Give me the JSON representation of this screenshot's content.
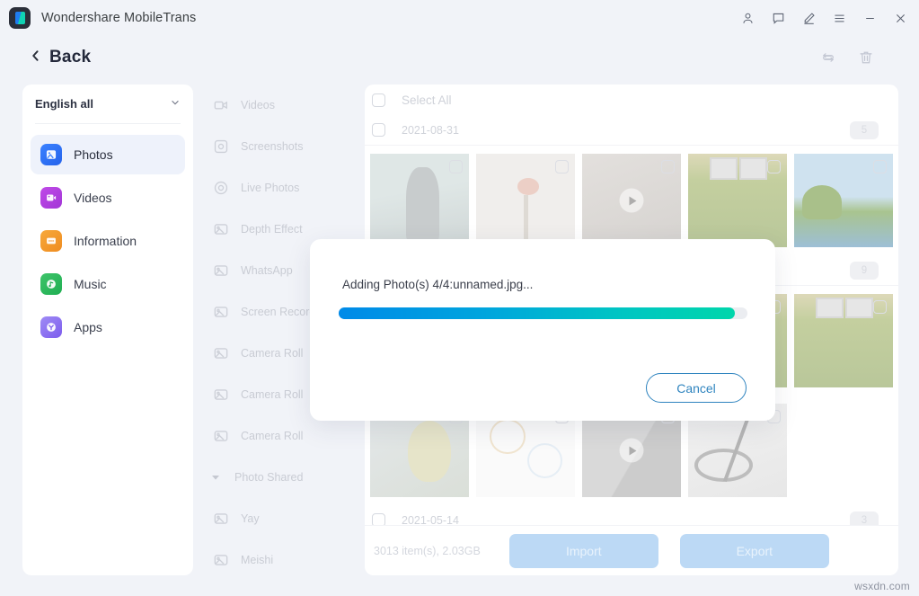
{
  "window": {
    "app_title": "Wondershare MobileTrans",
    "logo_icon": "mobiletrans-logo-icon",
    "controls": [
      {
        "name": "account-icon",
        "label": "Account"
      },
      {
        "name": "feedback-icon",
        "label": "Feedback"
      },
      {
        "name": "edit-icon",
        "label": "Edit"
      },
      {
        "name": "menu-icon",
        "label": "Menu"
      },
      {
        "name": "minimize-icon",
        "label": "Minimize"
      },
      {
        "name": "close-icon",
        "label": "Close"
      }
    ]
  },
  "header": {
    "back_label": "Back",
    "back_icon": "chevron-left-icon",
    "tools": [
      {
        "name": "refresh-icon",
        "label": "Refresh"
      },
      {
        "name": "trash-icon",
        "label": "Delete"
      }
    ]
  },
  "sidebar": {
    "language_selector": {
      "value": "English all",
      "caret_icon": "chevron-down-icon"
    },
    "items": [
      {
        "label": "Photos",
        "icon": "photos-icon",
        "active": true
      },
      {
        "label": "Videos",
        "icon": "videos-icon",
        "active": false
      },
      {
        "label": "Information",
        "icon": "information-icon",
        "active": false
      },
      {
        "label": "Music",
        "icon": "music-icon",
        "active": false
      },
      {
        "label": "Apps",
        "icon": "apps-icon",
        "active": false
      }
    ]
  },
  "albums": {
    "items": [
      {
        "label": "Videos",
        "icon": "video-album-icon",
        "type": "album"
      },
      {
        "label": "Screenshots",
        "icon": "screenshot-album-icon",
        "type": "album"
      },
      {
        "label": "Live Photos",
        "icon": "live-photo-album-icon",
        "type": "album"
      },
      {
        "label": "Depth Effect",
        "icon": "photo-album-icon",
        "type": "album"
      },
      {
        "label": "WhatsApp",
        "icon": "photo-album-icon",
        "type": "album"
      },
      {
        "label": "Screen Recorder",
        "icon": "photo-album-icon",
        "type": "album"
      },
      {
        "label": "Camera Roll",
        "icon": "photo-album-icon",
        "type": "album"
      },
      {
        "label": "Camera Roll",
        "icon": "photo-album-icon",
        "type": "album"
      },
      {
        "label": "Camera Roll",
        "icon": "photo-album-icon",
        "type": "album"
      },
      {
        "label": "Photo Shared",
        "icon": "caret-down-icon",
        "type": "group"
      },
      {
        "label": "Yay",
        "icon": "photo-album-icon",
        "type": "album"
      },
      {
        "label": "Meishi",
        "icon": "photo-album-icon",
        "type": "album"
      }
    ]
  },
  "content": {
    "select_all_label": "Select All",
    "date_groups": [
      {
        "date": "2021-08-31",
        "count": "5"
      },
      {
        "date": "",
        "count": "9"
      },
      {
        "date": "2021-05-14",
        "count": "3"
      }
    ],
    "thumbnails_row1": [
      {
        "name": "thumbnail-person",
        "kind": "photo"
      },
      {
        "name": "thumbnail-flowers",
        "kind": "photo"
      },
      {
        "name": "thumbnail-video-hand",
        "kind": "video"
      },
      {
        "name": "thumbnail-hedge",
        "kind": "photo"
      },
      {
        "name": "thumbnail-beach",
        "kind": "photo"
      }
    ],
    "thumbnails_row2": [
      {
        "name": "thumbnail-grass",
        "kind": "photo"
      }
    ],
    "thumbnails_row3": [
      {
        "name": "thumbnail-painting",
        "kind": "photo"
      },
      {
        "name": "thumbnail-infographic",
        "kind": "photo"
      },
      {
        "name": "thumbnail-video-room",
        "kind": "video"
      },
      {
        "name": "thumbnail-cable",
        "kind": "photo"
      }
    ],
    "footer": {
      "stats": "3013 item(s), 2.03GB",
      "import_label": "Import",
      "export_label": "Export"
    }
  },
  "dialog": {
    "message": "Adding Photo(s) 4/4:unnamed.jpg...",
    "progress_percent": 97,
    "cancel_label": "Cancel",
    "progress_color_start": "#008ae8",
    "progress_color_end": "#00d6ab"
  },
  "watermark": {
    "text": "wsxdn.com"
  }
}
